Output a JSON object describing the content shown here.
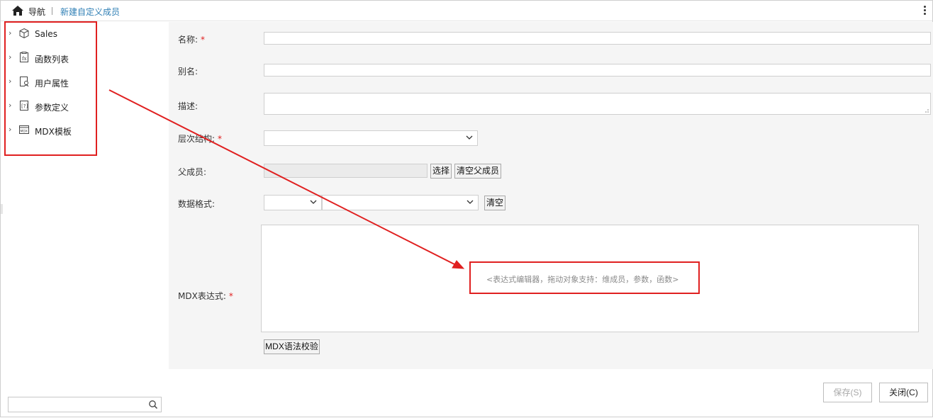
{
  "header": {
    "nav_label": "导航",
    "breadcrumb": "新建自定义成员"
  },
  "tree": {
    "items": [
      {
        "label": "Sales",
        "icon": "cube-icon"
      },
      {
        "label": "函数列表",
        "icon": "function-list-icon"
      },
      {
        "label": "用户属性",
        "icon": "user-property-icon"
      },
      {
        "label": "参数定义",
        "icon": "parameter-icon"
      },
      {
        "label": "MDX模板",
        "icon": "mdx-template-icon"
      }
    ],
    "search_placeholder": ""
  },
  "form": {
    "name_label": "名称:",
    "alias_label": "别名:",
    "desc_label": "描述:",
    "hierarchy_label": "层次结构:",
    "parent_label": "父成员:",
    "format_label": "数据格式:",
    "mdx_label": "MDX表达式:",
    "required_mark": "*",
    "select_button": "选择",
    "clear_parent_button": "清空父成员",
    "clear_button": "清空",
    "mdx_placeholder": "<表达式编辑器，拖动对象支持：维成员，参数，函数>",
    "validate_button": "MDX语法校验"
  },
  "footer": {
    "save_button": "保存(S)",
    "close_button": "关闭(C)"
  },
  "colors": {
    "annotation": "#e02020",
    "link": "#2f7fb5"
  }
}
